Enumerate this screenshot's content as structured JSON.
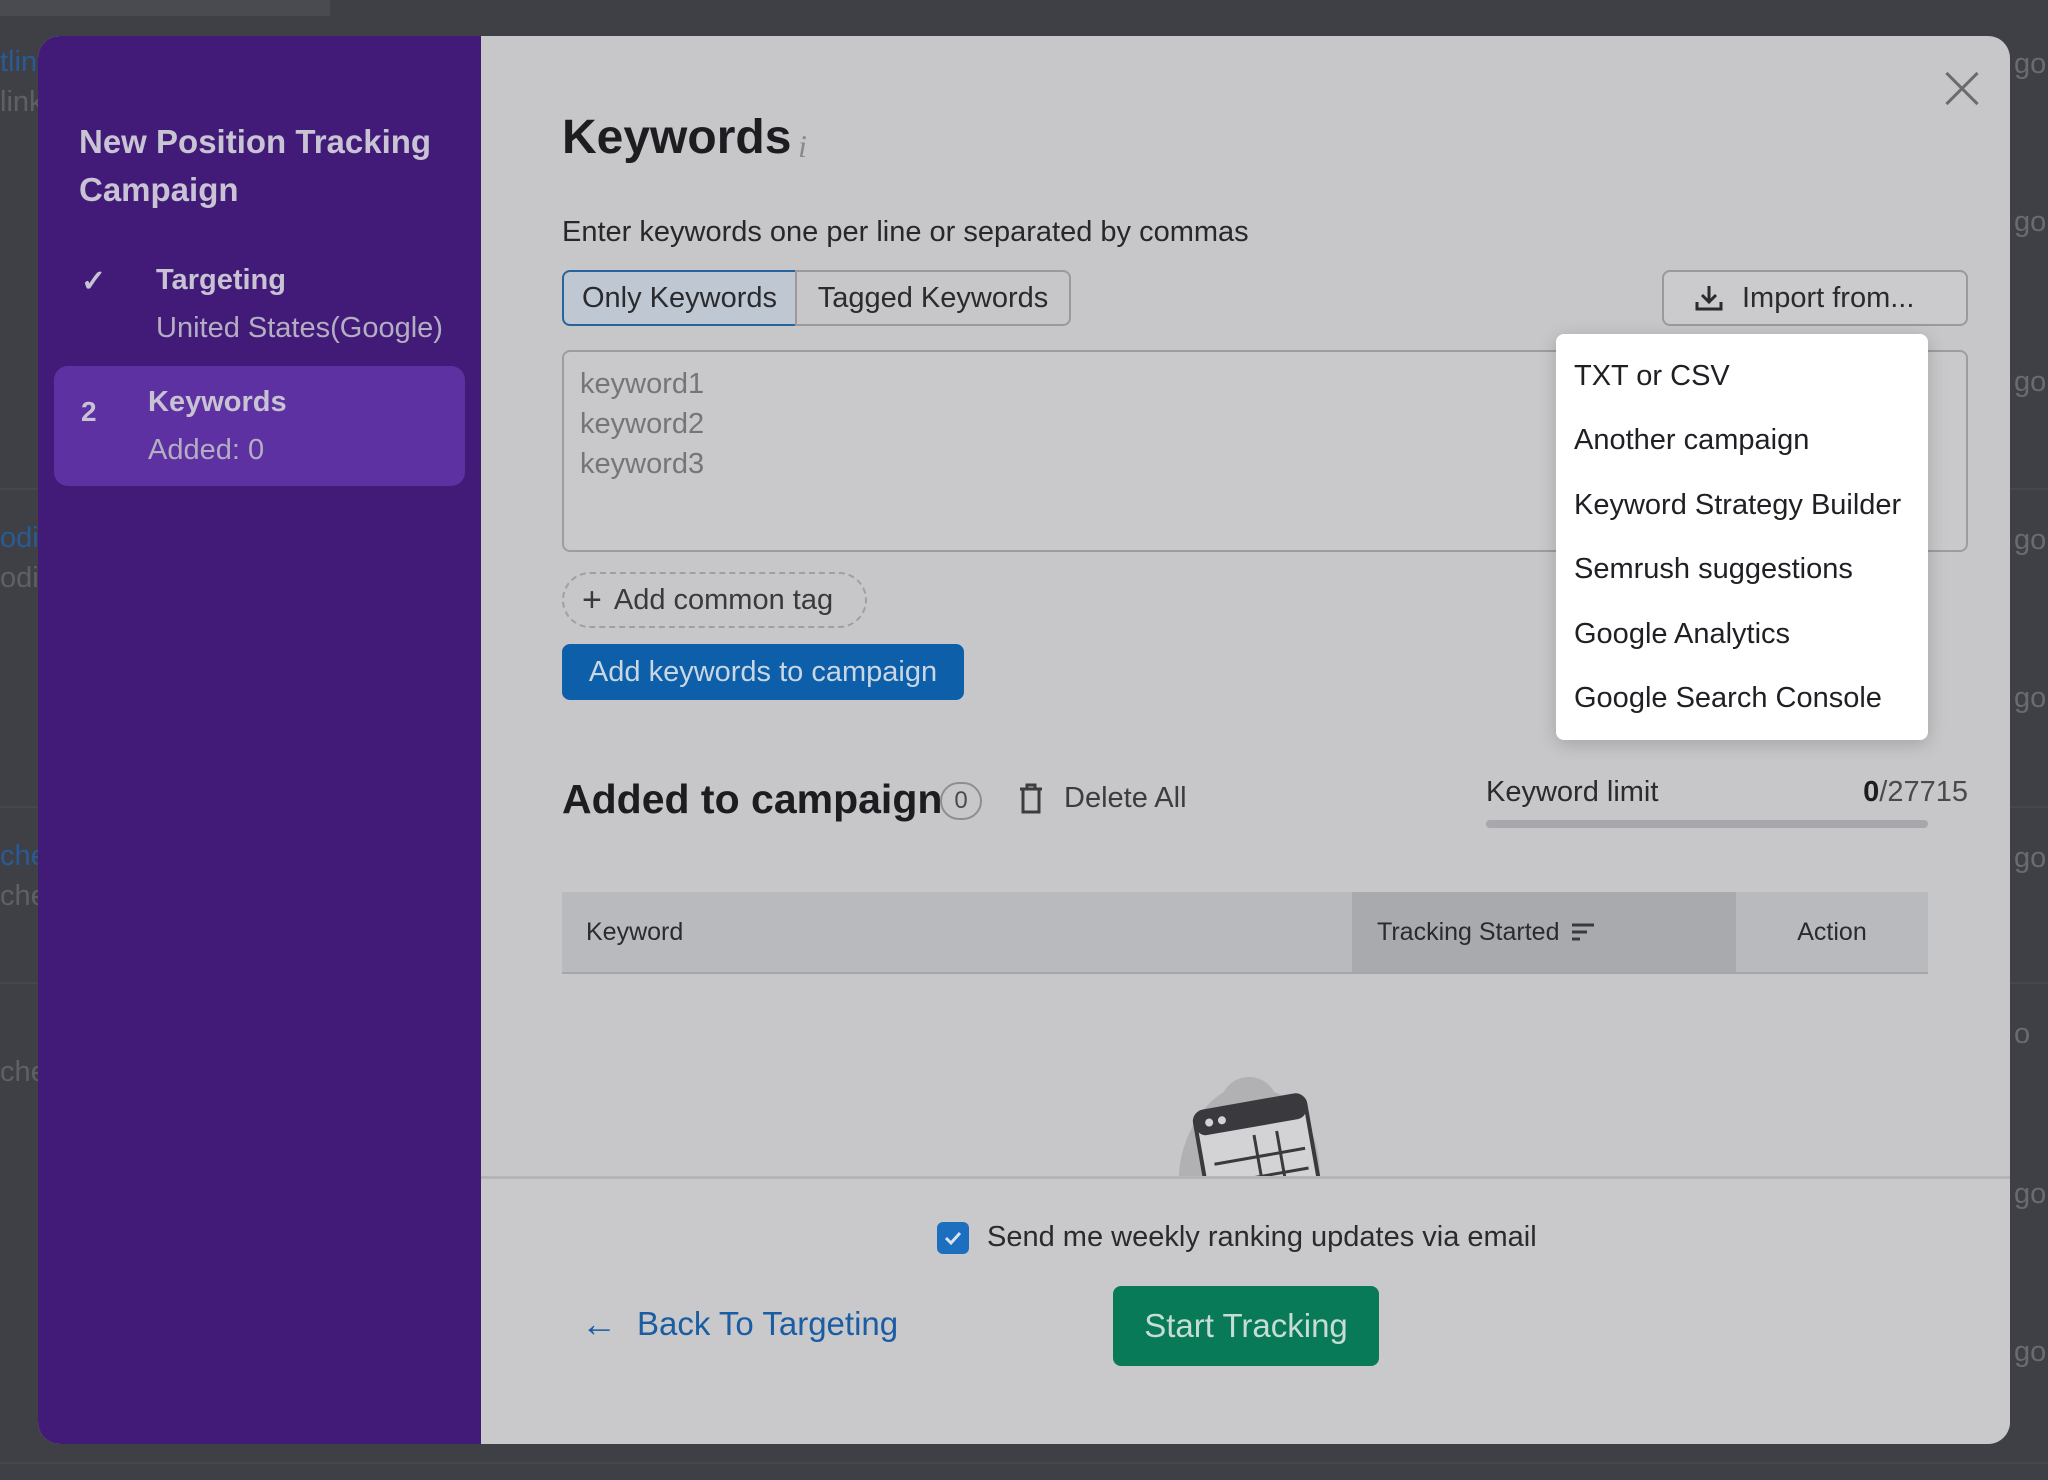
{
  "background": {
    "left_fragments": [
      "tlin",
      "link",
      "odi",
      "odir",
      "che",
      "che",
      "che"
    ],
    "right_fragments": [
      "go",
      "go",
      "go",
      "go",
      "go",
      "go",
      "go",
      "o",
      "go",
      "go"
    ]
  },
  "sidebar": {
    "title": "New Position Tracking Campaign",
    "steps": [
      {
        "marker": "✓",
        "label": "Targeting",
        "sub": "United States(Google)",
        "active": false
      },
      {
        "marker": "2",
        "label": "Keywords",
        "sub": "Added: 0",
        "active": true
      }
    ]
  },
  "main": {
    "title": "Keywords",
    "info_icon": "i",
    "instructions": "Enter keywords one per line or separated by commas",
    "tabs": [
      {
        "label": "Only Keywords",
        "selected": true
      },
      {
        "label": "Tagged Keywords",
        "selected": false
      }
    ],
    "import_button": "Import from...",
    "textarea_placeholder_lines": [
      "keyword1",
      "keyword2",
      "keyword3"
    ],
    "add_tag_label": "Add common tag",
    "add_keywords_button": "Add keywords to campaign",
    "added_section": {
      "title": "Added to campaign",
      "count": "0",
      "delete_all": "Delete All",
      "limit_label": "Keyword limit",
      "limit_used": "0",
      "limit_total": "/27715",
      "limit_fraction": 0
    },
    "table": {
      "columns": [
        "Keyword",
        "Tracking Started",
        "Action"
      ]
    }
  },
  "import_menu": {
    "items": [
      "TXT or CSV",
      "Another campaign",
      "Keyword Strategy Builder",
      "Semrush suggestions",
      "Google Analytics",
      "Google Search Console"
    ]
  },
  "footer": {
    "email_label": "Send me weekly ranking updates via email",
    "email_checked": true,
    "back_button": "Back To Targeting",
    "start_button": "Start Tracking"
  },
  "colors": {
    "sidebar_bg": "#421b79",
    "active_step_bg": "#5e31a3",
    "primary_blue": "#0c5fa8",
    "start_green": "#087a58"
  }
}
